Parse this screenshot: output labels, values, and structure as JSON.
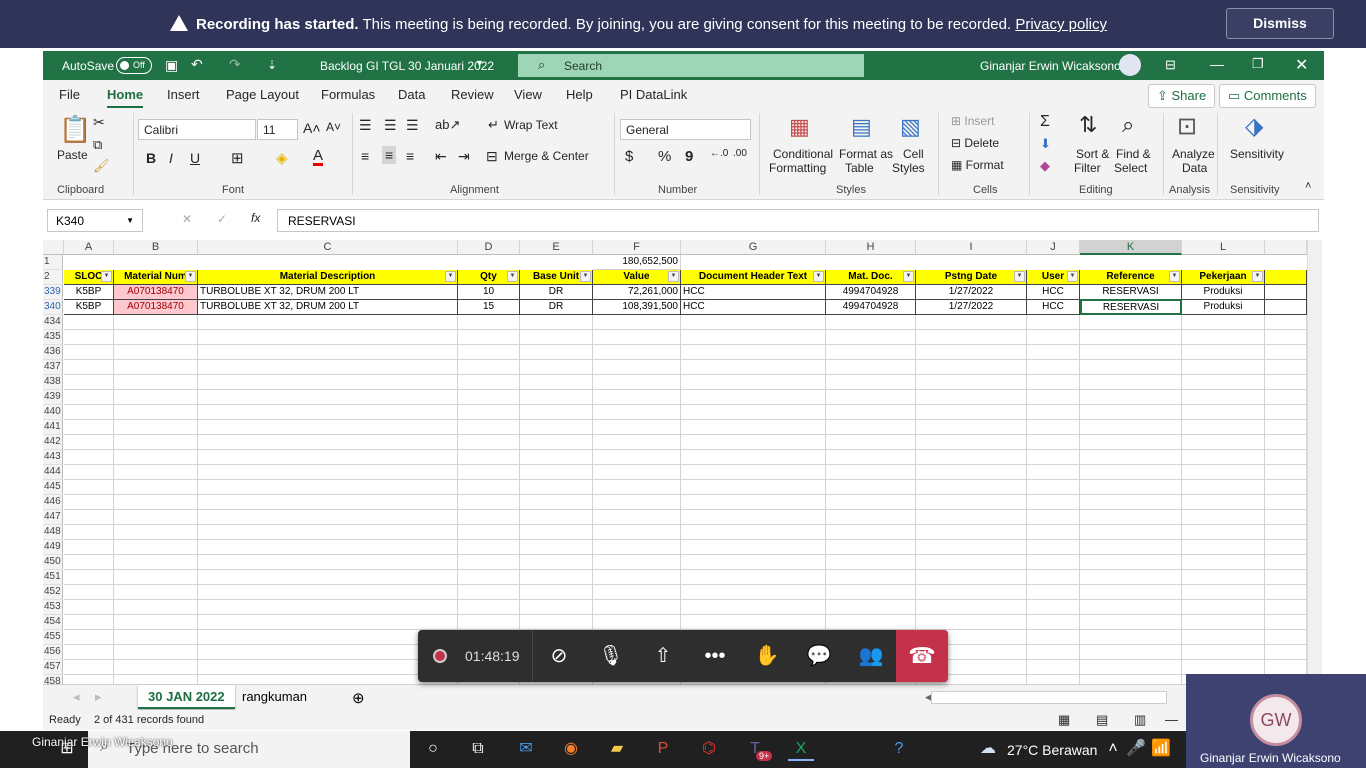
{
  "banner": {
    "bold": "Recording has started.",
    "text": " This meeting is being recorded. By joining, you are giving consent for this meeting to be recorded. ",
    "link": "Privacy policy",
    "dismiss": "Dismiss"
  },
  "titlebar": {
    "autosave": "AutoSave",
    "toggle": "Off",
    "filename": "Backlog GI TGL 30 Januari 2022",
    "search": "Search",
    "user": "Ginanjar Erwin Wicaksono"
  },
  "tabs": [
    "File",
    "Home",
    "Insert",
    "Page Layout",
    "Formulas",
    "Data",
    "Review",
    "View",
    "Help",
    "PI DataLink"
  ],
  "share": "Share",
  "comments": "Comments",
  "ribbon": {
    "paste": "Paste",
    "font_name": "Calibri",
    "font_size": "11",
    "wrap_text": "Wrap Text",
    "merge_center": "Merge & Center",
    "number_format": "General",
    "conditional": "Conditional",
    "formatting": "Formatting",
    "format_as": "Format as",
    "table": "Table",
    "cell": "Cell",
    "styles": "Styles",
    "insert": "Insert",
    "delete": "Delete",
    "format": "Format",
    "sort": "Sort &",
    "filter": "Filter",
    "find": "Find &",
    "select": "Select",
    "analyze": "Analyze",
    "data": "Data",
    "sensitivity": "Sensitivity",
    "groups": {
      "clipboard": "Clipboard",
      "font": "Font",
      "alignment": "Alignment",
      "number": "Number",
      "styles": "Styles",
      "cells": "Cells",
      "editing": "Editing",
      "analysis": "Analysis",
      "sensitivity": "Sensitivity"
    }
  },
  "formula": {
    "namebox": "K340",
    "fx": "fx",
    "value": "RESERVASI"
  },
  "columns": [
    "A",
    "B",
    "C",
    "D",
    "E",
    "F",
    "G",
    "H",
    "I",
    "J",
    "K",
    "L"
  ],
  "row1": {
    "num": "1",
    "F": "180,652,500"
  },
  "headers": {
    "num": "2",
    "A": "SLOC",
    "B": "Material Num",
    "C": "Material Description",
    "D": "Qty",
    "E": "Base Unit",
    "F": "Value",
    "G": "Document Header Text",
    "H": "Mat. Doc.",
    "I": "Pstng Date",
    "J": "User",
    "K": "Reference",
    "L": "Pekerjaan"
  },
  "rows": [
    {
      "num": "339",
      "A": "K5BP",
      "B": "A070138470",
      "C": "TURBOLUBE XT 32, DRUM 200 LT",
      "D": "10",
      "E": "DR",
      "F": "72,261,000",
      "G": "HCC",
      "H": "4994704928",
      "I": "1/27/2022",
      "J": "HCC",
      "K": "RESERVASI",
      "L": "Produksi"
    },
    {
      "num": "340",
      "A": "K5BP",
      "B": "A070138470",
      "C": "TURBOLUBE XT 32, DRUM 200 LT",
      "D": "15",
      "E": "DR",
      "F": "108,391,500",
      "G": "HCC",
      "H": "4994704928",
      "I": "1/27/2022",
      "J": "HCC",
      "K": "RESERVASI",
      "L": "Produksi"
    }
  ],
  "empty_rows": [
    "434",
    "435",
    "436",
    "437",
    "438",
    "439",
    "440",
    "441",
    "442",
    "443",
    "444",
    "445",
    "446",
    "447",
    "448",
    "449",
    "450",
    "451",
    "452",
    "453",
    "454",
    "455",
    "456",
    "457",
    "458"
  ],
  "sheet_tabs": [
    "30 JAN 2022",
    "rangkuman"
  ],
  "status": {
    "ready": "Ready",
    "records": "2 of 431 records found"
  },
  "call": {
    "time": "01:48:19"
  },
  "taskbar": {
    "search": "Type here to search",
    "weather": "27°C  Berawan",
    "badge": "9+"
  },
  "presenter": "Ginanjar Erwin Wicaksono",
  "tile": {
    "initials": "GW",
    "name": "Ginanjar Erwin Wicaksono"
  }
}
